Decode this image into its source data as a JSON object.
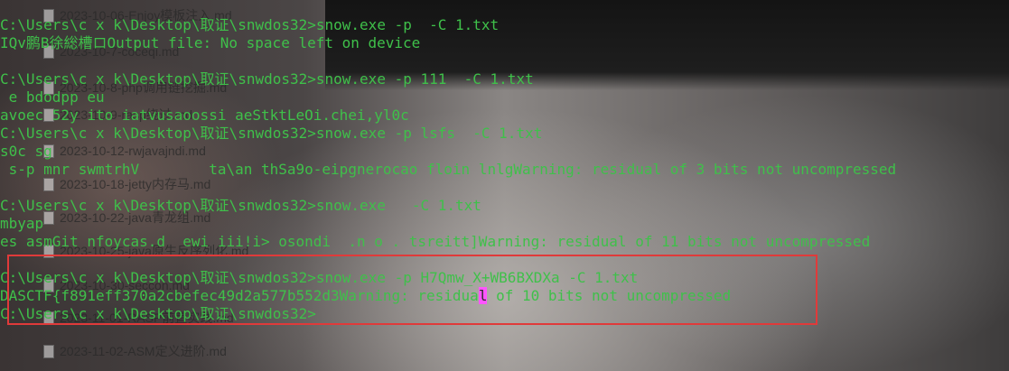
{
  "explorer": {
    "files": [
      "2023-10-06-Enjoy模板注入.md",
      "2023-10-7-coceqi.md",
      "2023-10-8-php调用链挖掘.md",
      "2023-10-9-rasp绕过.md",
      "2023-10-12-rwjavajndi.md",
      "2023-10-18-jetty内存马.md",
      "2023-10-22-java青龙组.md",
      "2023-10-25-java原生反序列化.md",
      "2023-10-30-seccon.md",
      "2023-11-01-RASP前置实践.md",
      "2023-11-02-ASM定义进阶.md"
    ]
  },
  "terminal": {
    "lines": [
      "C:\\Users\\c x k\\Desktop\\取证\\snwdos32>snow.exe -p  -C 1.txt",
      "IQv鹏B徐総槽ロOutput file: No space left on device",
      "",
      "C:\\Users\\c x k\\Desktop\\取证\\snwdos32>snow.exe -p 111  -C 1.txt",
      " e bdodpp eu",
      "avoec 52y ito iatvusaoossi aeStktLeOi.chei,yl0c",
      "C:\\Users\\c x k\\Desktop\\取证\\snwdos32>snow.exe -p lsfs  -C 1.txt",
      "s0c sg",
      " s-p mnr swmtrhV        ta\\an thSa9o-eipgnerocao floin lnlgWarning: residual of 3 bits not uncompressed",
      "",
      "C:\\Users\\c x k\\Desktop\\取证\\snwdos32>snow.exe   -C 1.txt",
      "mbyap",
      "es asmGit nfoycas.d  ewi iii!i> osondi  .n o . tsreitt]Warning: residual of 11 bits not uncompressed",
      "",
      "C:\\Users\\c x k\\Desktop\\取证\\snwdos32>snow.exe -p H7Qmw_X+WB6BXDXa -C 1.txt",
      "DASCTF{f891eff370a2cbefec49d2a577b552d3Warning: residua",
      "C:\\Users\\c x k\\Desktop\\取证\\snwdos32>"
    ],
    "cursor_char": "l",
    "flag_line_tail": " of 10 bits not uncompressed"
  },
  "colors": {
    "terminal_text": "#3fc04a",
    "highlight_border": "#e03a3a",
    "cursor": "#ff55ff"
  }
}
